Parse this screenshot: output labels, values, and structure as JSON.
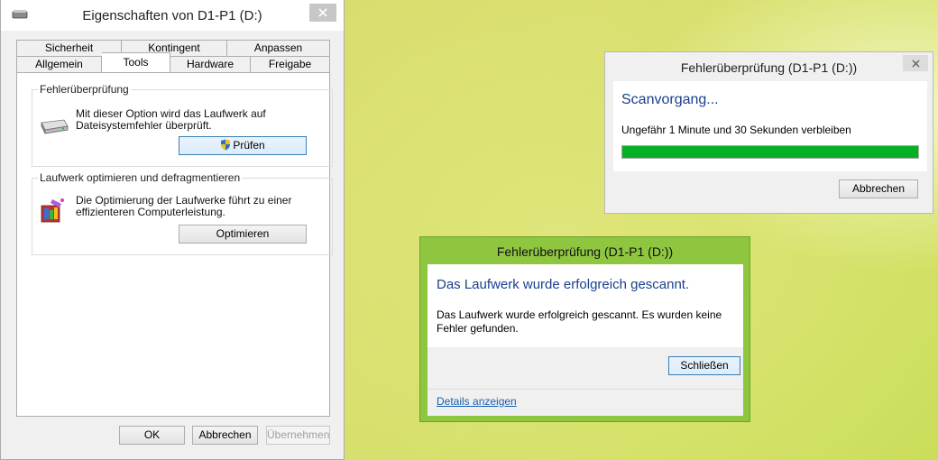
{
  "properties": {
    "title": "Eigenschaften von D1-P1 (D:)",
    "tabs_row1": [
      "Sicherheit",
      "Kontingent",
      "Anpassen"
    ],
    "tabs_row2": [
      "Allgemein",
      "Tools",
      "Hardware",
      "Freigabe"
    ],
    "active_tab": "Tools",
    "error_check": {
      "label": "Fehlerüberprüfung",
      "desc_line1": "Mit dieser Option wird das Laufwerk auf",
      "desc_line2": "Dateisystemfehler überprüft.",
      "button": "Prüfen"
    },
    "optimize": {
      "label": "Laufwerk optimieren und defragmentieren",
      "desc_line1": "Die Optimierung der Laufwerke führt zu einer",
      "desc_line2": "effizienteren Computerleistung.",
      "button": "Optimieren"
    },
    "footer": {
      "ok": "OK",
      "cancel": "Abbrechen",
      "apply": "Übernehmen"
    }
  },
  "scan_dialog": {
    "title": "Fehlerüberprüfung (D1-P1 (D:))",
    "heading": "Scanvorgang...",
    "remaining": "Ungefähr 1 Minute und 30 Sekunden verbleiben",
    "progress_fraction": 1.0,
    "cancel": "Abbrechen",
    "progress_color": "#06b025"
  },
  "done_dialog": {
    "title": "Fehlerüberprüfung (D1-P1 (D:))",
    "heading": "Das Laufwerk wurde erfolgreich gescannt.",
    "msg_line1": "Das Laufwerk wurde erfolgreich gescannt. Es wurden keine",
    "msg_line2": "Fehler gefunden.",
    "close": "Schließen",
    "details": "Details anzeigen",
    "frame_color": "#8fc640"
  }
}
